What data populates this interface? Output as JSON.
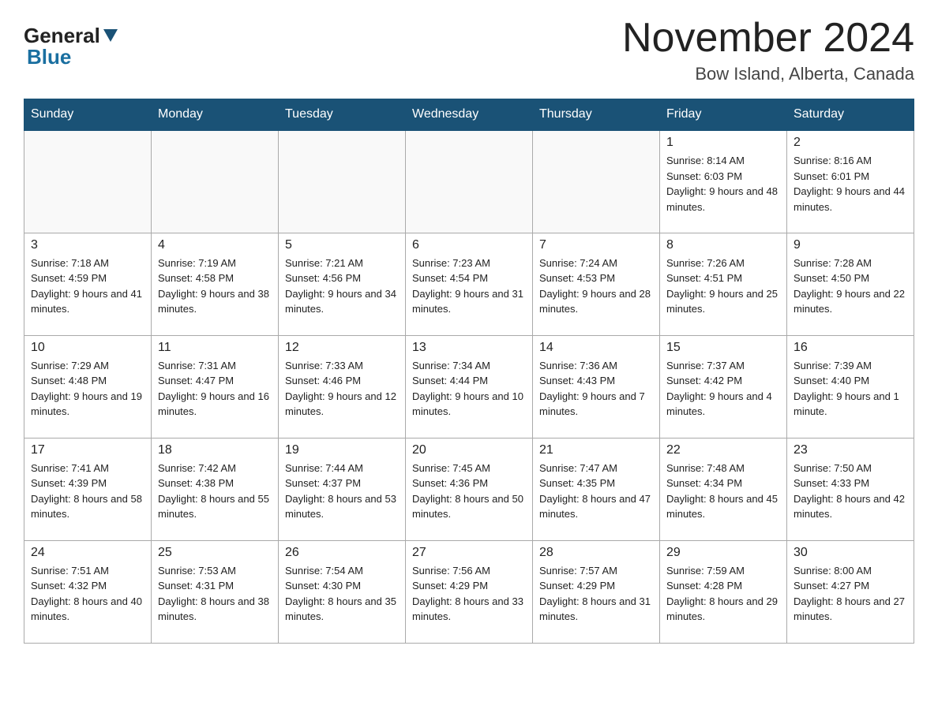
{
  "header": {
    "logo": {
      "general": "General",
      "blue": "Blue"
    },
    "month": "November 2024",
    "location": "Bow Island, Alberta, Canada"
  },
  "weekdays": [
    "Sunday",
    "Monday",
    "Tuesday",
    "Wednesday",
    "Thursday",
    "Friday",
    "Saturday"
  ],
  "weeks": [
    [
      {
        "day": "",
        "info": ""
      },
      {
        "day": "",
        "info": ""
      },
      {
        "day": "",
        "info": ""
      },
      {
        "day": "",
        "info": ""
      },
      {
        "day": "",
        "info": ""
      },
      {
        "day": "1",
        "info": "Sunrise: 8:14 AM\nSunset: 6:03 PM\nDaylight: 9 hours and 48 minutes."
      },
      {
        "day": "2",
        "info": "Sunrise: 8:16 AM\nSunset: 6:01 PM\nDaylight: 9 hours and 44 minutes."
      }
    ],
    [
      {
        "day": "3",
        "info": "Sunrise: 7:18 AM\nSunset: 4:59 PM\nDaylight: 9 hours and 41 minutes."
      },
      {
        "day": "4",
        "info": "Sunrise: 7:19 AM\nSunset: 4:58 PM\nDaylight: 9 hours and 38 minutes."
      },
      {
        "day": "5",
        "info": "Sunrise: 7:21 AM\nSunset: 4:56 PM\nDaylight: 9 hours and 34 minutes."
      },
      {
        "day": "6",
        "info": "Sunrise: 7:23 AM\nSunset: 4:54 PM\nDaylight: 9 hours and 31 minutes."
      },
      {
        "day": "7",
        "info": "Sunrise: 7:24 AM\nSunset: 4:53 PM\nDaylight: 9 hours and 28 minutes."
      },
      {
        "day": "8",
        "info": "Sunrise: 7:26 AM\nSunset: 4:51 PM\nDaylight: 9 hours and 25 minutes."
      },
      {
        "day": "9",
        "info": "Sunrise: 7:28 AM\nSunset: 4:50 PM\nDaylight: 9 hours and 22 minutes."
      }
    ],
    [
      {
        "day": "10",
        "info": "Sunrise: 7:29 AM\nSunset: 4:48 PM\nDaylight: 9 hours and 19 minutes."
      },
      {
        "day": "11",
        "info": "Sunrise: 7:31 AM\nSunset: 4:47 PM\nDaylight: 9 hours and 16 minutes."
      },
      {
        "day": "12",
        "info": "Sunrise: 7:33 AM\nSunset: 4:46 PM\nDaylight: 9 hours and 12 minutes."
      },
      {
        "day": "13",
        "info": "Sunrise: 7:34 AM\nSunset: 4:44 PM\nDaylight: 9 hours and 10 minutes."
      },
      {
        "day": "14",
        "info": "Sunrise: 7:36 AM\nSunset: 4:43 PM\nDaylight: 9 hours and 7 minutes."
      },
      {
        "day": "15",
        "info": "Sunrise: 7:37 AM\nSunset: 4:42 PM\nDaylight: 9 hours and 4 minutes."
      },
      {
        "day": "16",
        "info": "Sunrise: 7:39 AM\nSunset: 4:40 PM\nDaylight: 9 hours and 1 minute."
      }
    ],
    [
      {
        "day": "17",
        "info": "Sunrise: 7:41 AM\nSunset: 4:39 PM\nDaylight: 8 hours and 58 minutes."
      },
      {
        "day": "18",
        "info": "Sunrise: 7:42 AM\nSunset: 4:38 PM\nDaylight: 8 hours and 55 minutes."
      },
      {
        "day": "19",
        "info": "Sunrise: 7:44 AM\nSunset: 4:37 PM\nDaylight: 8 hours and 53 minutes."
      },
      {
        "day": "20",
        "info": "Sunrise: 7:45 AM\nSunset: 4:36 PM\nDaylight: 8 hours and 50 minutes."
      },
      {
        "day": "21",
        "info": "Sunrise: 7:47 AM\nSunset: 4:35 PM\nDaylight: 8 hours and 47 minutes."
      },
      {
        "day": "22",
        "info": "Sunrise: 7:48 AM\nSunset: 4:34 PM\nDaylight: 8 hours and 45 minutes."
      },
      {
        "day": "23",
        "info": "Sunrise: 7:50 AM\nSunset: 4:33 PM\nDaylight: 8 hours and 42 minutes."
      }
    ],
    [
      {
        "day": "24",
        "info": "Sunrise: 7:51 AM\nSunset: 4:32 PM\nDaylight: 8 hours and 40 minutes."
      },
      {
        "day": "25",
        "info": "Sunrise: 7:53 AM\nSunset: 4:31 PM\nDaylight: 8 hours and 38 minutes."
      },
      {
        "day": "26",
        "info": "Sunrise: 7:54 AM\nSunset: 4:30 PM\nDaylight: 8 hours and 35 minutes."
      },
      {
        "day": "27",
        "info": "Sunrise: 7:56 AM\nSunset: 4:29 PM\nDaylight: 8 hours and 33 minutes."
      },
      {
        "day": "28",
        "info": "Sunrise: 7:57 AM\nSunset: 4:29 PM\nDaylight: 8 hours and 31 minutes."
      },
      {
        "day": "29",
        "info": "Sunrise: 7:59 AM\nSunset: 4:28 PM\nDaylight: 8 hours and 29 minutes."
      },
      {
        "day": "30",
        "info": "Sunrise: 8:00 AM\nSunset: 4:27 PM\nDaylight: 8 hours and 27 minutes."
      }
    ]
  ]
}
